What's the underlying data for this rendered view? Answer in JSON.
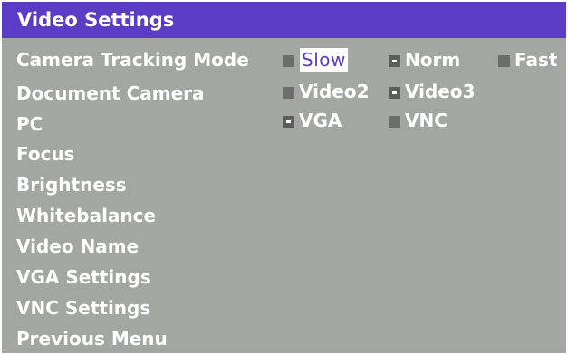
{
  "header": {
    "title": "Video Settings"
  },
  "menu": {
    "items": [
      {
        "label": "Camera Tracking Mode"
      },
      {
        "label": "Document Camera"
      },
      {
        "label": "PC"
      },
      {
        "label": "Focus"
      },
      {
        "label": "Brightness"
      },
      {
        "label": "Whitebalance"
      },
      {
        "label": "Video Name"
      },
      {
        "label": "VGA Settings"
      },
      {
        "label": "VNC Settings"
      },
      {
        "label": "Previous Menu"
      }
    ]
  },
  "options": {
    "camera_tracking": [
      {
        "label": "Slow",
        "selected": false,
        "highlighted": true
      },
      {
        "label": "Norm",
        "selected": true,
        "highlighted": false
      },
      {
        "label": "Fast",
        "selected": false,
        "highlighted": false
      }
    ],
    "document_camera": [
      {
        "label": "Video2",
        "selected": false,
        "highlighted": false
      },
      {
        "label": "Video3",
        "selected": true,
        "highlighted": false
      }
    ],
    "pc": [
      {
        "label": "VGA",
        "selected": true,
        "highlighted": false
      },
      {
        "label": "VNC",
        "selected": false,
        "highlighted": false
      }
    ]
  },
  "colors": {
    "title_bar": "#5b3cc4",
    "background": "#a4a6a1",
    "text": "#ffffff",
    "checkbox": "#6d6e6b",
    "highlight_text": "#5b3cc4"
  }
}
